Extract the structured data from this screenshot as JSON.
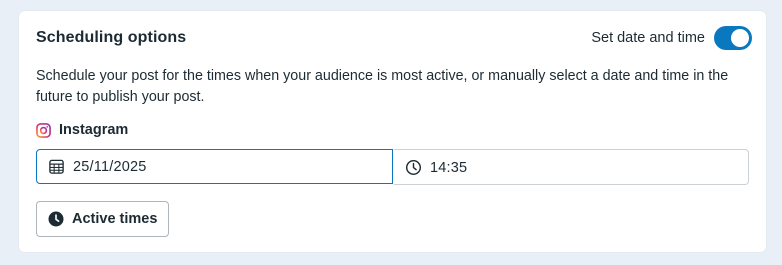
{
  "scheduling": {
    "title": "Scheduling options",
    "toggle_label": "Set date and time",
    "toggle_on": true,
    "description": "Schedule your post for the times when your audience is most active, or manually select a date and time in the future to publish your post.",
    "platform": {
      "label": "Instagram",
      "icon": "instagram-icon"
    },
    "date": {
      "value": "25/11/2025",
      "icon": "calendar-icon"
    },
    "time": {
      "value": "14:35",
      "icon": "clock-icon"
    },
    "active_times_button": {
      "label": "Active times",
      "icon": "clock-filled-icon"
    },
    "colors": {
      "accent": "#0a78be",
      "text": "#1c2b33",
      "background": "#e9eff6"
    }
  }
}
